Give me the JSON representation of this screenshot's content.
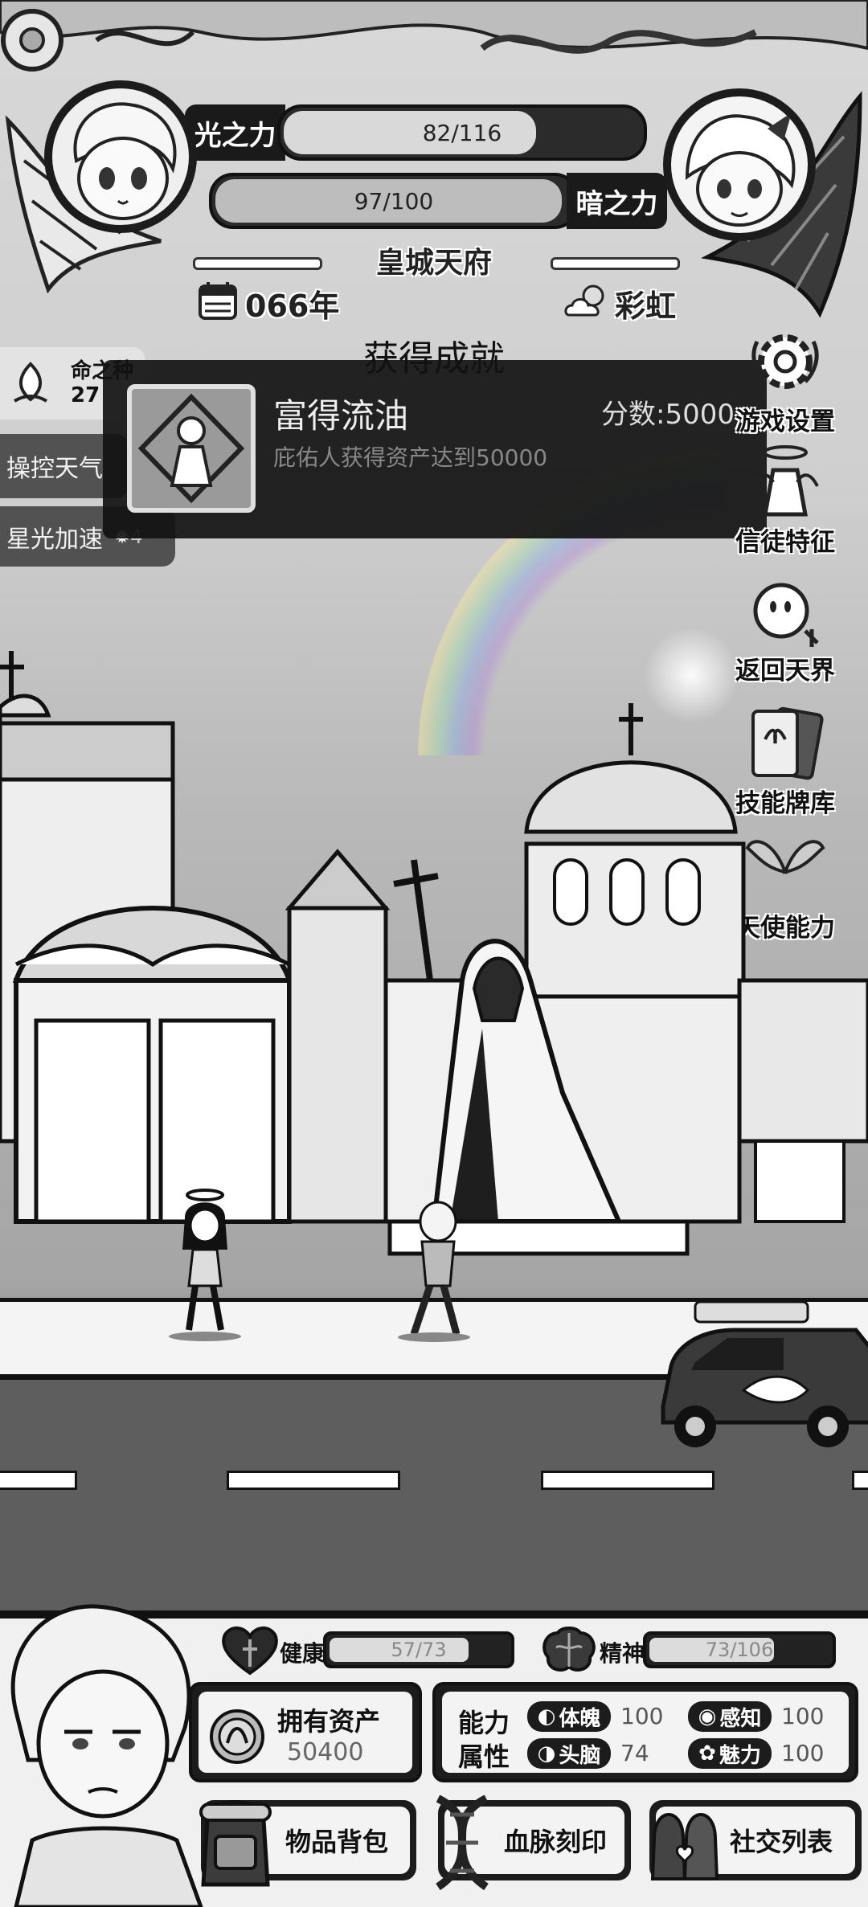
{
  "hud": {
    "light_power_label": "光之力",
    "light_power_value": "82/116",
    "light_power_fraction": 0.707,
    "dark_power_label": "暗之力",
    "dark_power_value": "97/100",
    "dark_power_fraction": 0.97,
    "location": "皇城天府",
    "year": "066年",
    "weather": "彩虹"
  },
  "left_skills": {
    "fate_label": "命之种",
    "fate_count": "27",
    "items": [
      {
        "label": "操控天气"
      },
      {
        "label": "星光加速",
        "count": "4"
      }
    ]
  },
  "achievement": {
    "header": "获得成就",
    "title": "富得流油",
    "score": "分数:5000",
    "description": "庇佑人获得资产达到50000"
  },
  "side_menu": [
    {
      "label": "游戏设置",
      "icon": "gear-icon"
    },
    {
      "label": "信徒特征",
      "icon": "believer-icon"
    },
    {
      "label": "返回天界",
      "icon": "heaven-icon"
    },
    {
      "label": "技能牌库",
      "icon": "cards-icon"
    },
    {
      "label": "天使能力",
      "icon": "angel-wings-icon"
    }
  ],
  "character": {
    "health_label": "健康",
    "health_value": "57/73",
    "health_fraction": 0.78,
    "spirit_label": "精神",
    "spirit_value": "73/106",
    "spirit_fraction": 0.69,
    "assets_label": "拥有资产",
    "assets_value": "50400",
    "attributes_label_1": "能力",
    "attributes_label_2": "属性",
    "stats": [
      {
        "label": "体魄",
        "value": "100"
      },
      {
        "label": "感知",
        "value": "100"
      },
      {
        "label": "头脑",
        "value": "74"
      },
      {
        "label": "魅力",
        "value": "100"
      }
    ]
  },
  "bottom_menu": [
    {
      "label": "物品背包"
    },
    {
      "label": "血脉刻印"
    },
    {
      "label": "社交列表"
    }
  ]
}
